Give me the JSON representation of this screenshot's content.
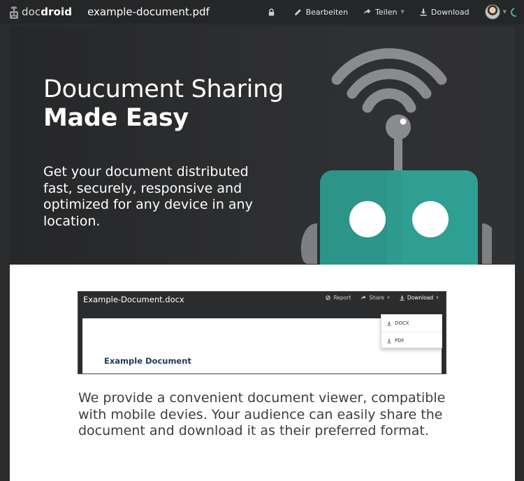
{
  "header": {
    "logo": {
      "text_light": "doc",
      "text_bold": "droid"
    },
    "document_title": "example-document.pdf",
    "nav": {
      "edit_label": "Bearbeiten",
      "share_label": "Teilen",
      "download_label": "Download"
    },
    "icons": {
      "lock": "lock-icon",
      "edit": "pencil-icon",
      "share": "share-arrow-icon",
      "download": "download-icon",
      "avatar": "user-avatar",
      "loading": "spinner-icon"
    }
  },
  "hero": {
    "title_line1": "Doucument Sharing",
    "title_line2": "Made Easy",
    "text": "Get your document distributed fast, securely, responsive and optimized for any device in any location.",
    "illustration": "robot-wifi-illustration"
  },
  "preview": {
    "title": "Example-Document.docx",
    "nav": {
      "report_label": "Report",
      "share_label": "Share",
      "download_label": "Download"
    },
    "dropdown": [
      "DOCX",
      "PDF"
    ],
    "doc_heading": "Example Document"
  },
  "description": "We provide a convenient document viewer, compatible with mobile devies. Your audience can easily share the document and download it as their preferred format.",
  "colors": {
    "topbar_bg": "#252628",
    "hero_bg": "#2c2d2f",
    "robot_teal": "#2f9f93",
    "robot_gray": "#8a8b8d",
    "accent": "#3cb9a9",
    "doc_heading": "#1f3a5a"
  }
}
